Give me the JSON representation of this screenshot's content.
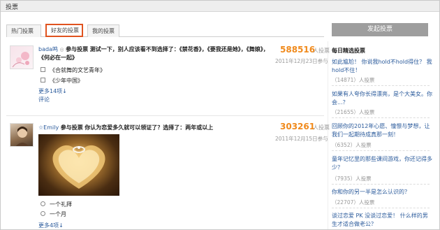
{
  "window": {
    "title": "投票"
  },
  "tabs": [
    {
      "label": "热门投票"
    },
    {
      "label": "好友的投票"
    },
    {
      "label": "我的投票"
    }
  ],
  "launch_button": "发起投票",
  "feed": [
    {
      "user": "bada鸣",
      "action": "参与投票",
      "question": "测试一下，别人应该看不到选择了：《禁花香》，《要我还是她》，《舞娘》，《何必在一起》",
      "options": [
        "《合就舞的文艺青年》",
        "《少年中国》"
      ],
      "more": "更多14项↓",
      "comment": "评论",
      "count": "588516",
      "count_unit": "人投票",
      "date": "2011年12月23日参与"
    },
    {
      "user": "☆Emily",
      "action": "参与投票",
      "question": "你认为恋爱多久就可以领证了？选择了：两年或以上",
      "options": [
        "一个礼拜",
        "一个月"
      ],
      "more": "更多4项↓",
      "count": "303261",
      "count_unit": "人投票",
      "date": "2011年12月15日参与"
    }
  ],
  "recommend": {
    "title": "每日精选投票",
    "items": [
      {
        "q": "如此尴尬！ 你说我hold不hold得住？ 我hold不住！",
        "c": "（14871）人投票"
      },
      {
        "q": "如果有人夸你长得漂亮，是个大美女。你会...？",
        "c": "（21655）人投票"
      },
      {
        "q": "回顾你的2012年心愿、憧憬与梦想，让我们一起期待成真那一刻！",
        "c": "（6352）人投票"
      },
      {
        "q": "童年记忆里的那些课间游戏，你还记得多少？",
        "c": "（7935）人投票"
      },
      {
        "q": "你和你的另一半是怎么认识的？",
        "c": "（22707）人投票"
      },
      {
        "q": "谈过恋爱 PK 没谈过恋爱！ 什么样的男生才适合做老公？",
        "c": ""
      }
    ]
  }
}
